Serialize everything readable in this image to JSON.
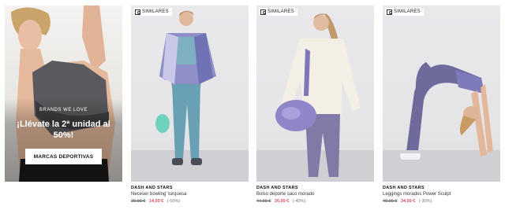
{
  "promo": {
    "eyebrow": "BRANDS WE LOVE",
    "title": "¡Llévate la 2ª unidad al 50%!",
    "button_label": "MARCAS DEPORTIVAS"
  },
  "badge_label": "SIMILARES",
  "products": [
    {
      "brand": "DASH AND STARS",
      "name": "Neceser bowling' turquesa",
      "old_price": "29,99 €",
      "new_price": "14,99 €",
      "discount": "(-50%)"
    },
    {
      "brand": "DASH AND STARS",
      "name": "Bolso deporte saco morado",
      "old_price": "44,99 €",
      "new_price": "26,99 €",
      "discount": "(-40%)"
    },
    {
      "brand": "DASH AND STARS",
      "name": "Leggings morados Power Sculpt",
      "old_price": "49,99 €",
      "new_price": "34,99 €",
      "discount": "(-30%)"
    }
  ]
}
